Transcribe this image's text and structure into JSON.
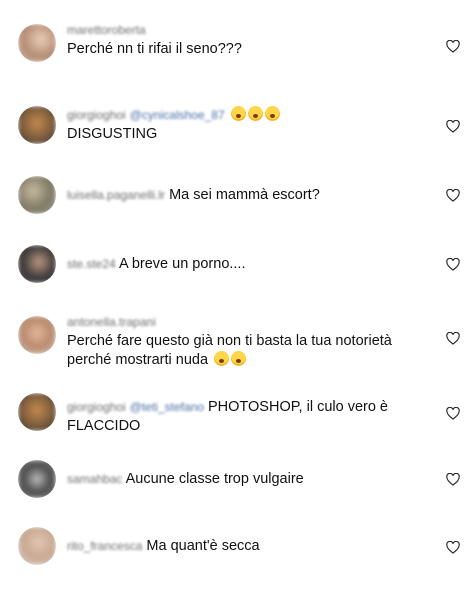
{
  "comments": [
    {
      "username": "marettoroberta",
      "mention": "",
      "text": "Perché nn ti rifai il seno???",
      "emoji_count": 0,
      "layout": "stacked"
    },
    {
      "username": "giorgioghoi",
      "mention": "@cynicalshoe_87",
      "text": "DISGUSTING",
      "emoji_count": 3,
      "emoji": "face-with-tears-of-joy-icon",
      "layout": "stacked-mention"
    },
    {
      "username": "luisella.paganelli.lr",
      "mention": "",
      "text": "Ma sei mammà escort?",
      "emoji_count": 0,
      "layout": "inline"
    },
    {
      "username": "ste.ste24",
      "mention": "",
      "text": "A breve un porno....",
      "emoji_count": 0,
      "layout": "inline"
    },
    {
      "username": "antonella.trapani",
      "mention": "",
      "text": "Perché fare questo già non ti basta la tua notorietà perché mostrarti nuda",
      "emoji_count": 2,
      "emoji": "hushed-face-icon",
      "layout": "stacked"
    },
    {
      "username": "giorgioghoi",
      "mention": "@teti_stefano",
      "text": "PHOTOSHOP, il culo vero è FLACCIDO",
      "emoji_count": 0,
      "layout": "inline-mention"
    },
    {
      "username": "samahbac",
      "mention": "",
      "text": "Aucune classe trop vulgaire",
      "emoji_count": 0,
      "layout": "inline"
    },
    {
      "username": "rito_francesca",
      "mention": "",
      "text": "Ma quant'è secca",
      "emoji_count": 0,
      "layout": "inline"
    }
  ],
  "colors": {
    "username": "#6e6e6e",
    "mention": "#4a6fa5",
    "text": "#111111",
    "heart_outline": "#262626"
  }
}
